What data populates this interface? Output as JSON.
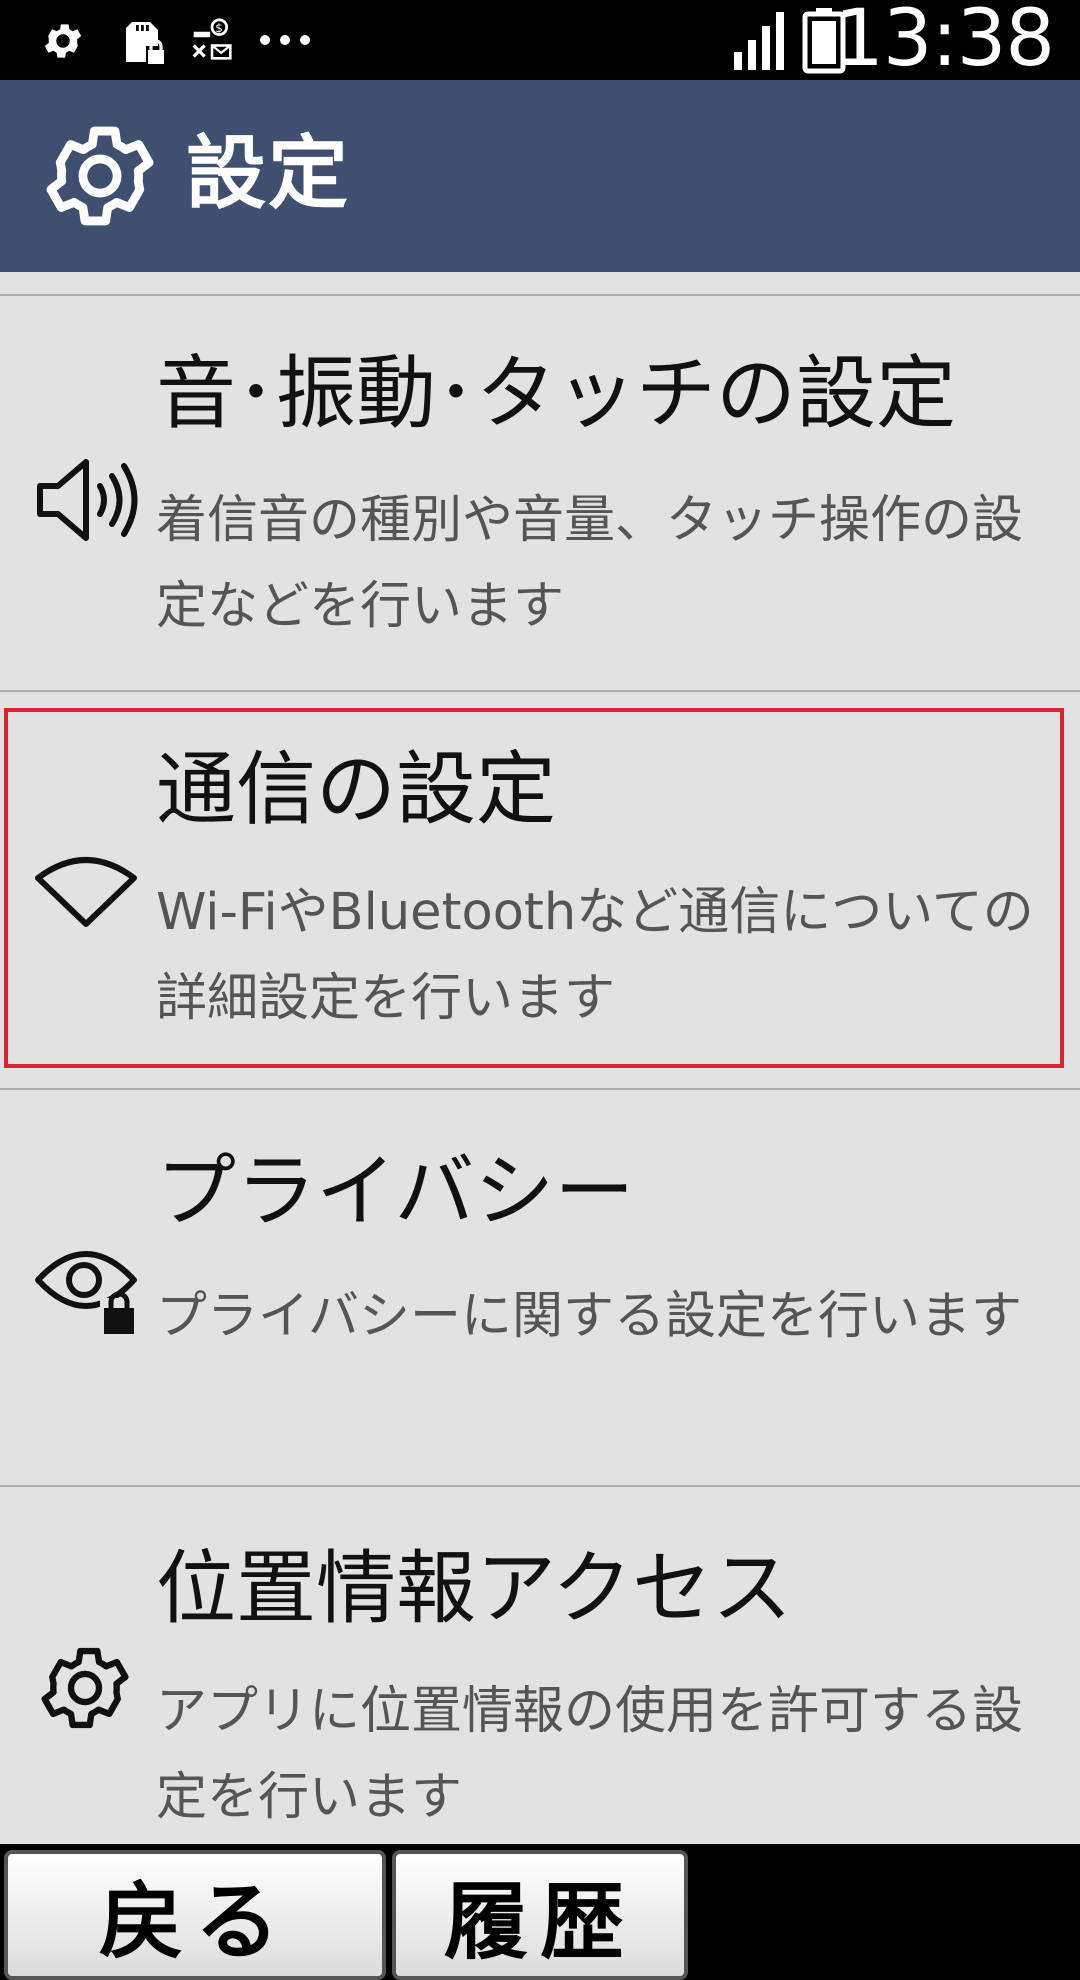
{
  "status_bar": {
    "time": "13:38",
    "icons": [
      "settings-icon",
      "sd-card-lock-icon",
      "key-dollar-mail-icon",
      "more-icon",
      "signal-icon",
      "battery-icon"
    ]
  },
  "app_bar": {
    "title": "設定",
    "icon": "gear-icon"
  },
  "items": [
    {
      "title": "音･振動･タッチの設定",
      "description": "着信音の種別や音量、タッチ操作の設定などを行います",
      "icon": "speaker-icon"
    },
    {
      "title": "通信の設定",
      "description": "Wi-FiやBluetoothなど通信についての詳細設定を行います",
      "icon": "wifi-icon",
      "selected": true
    },
    {
      "title": "プライバシー",
      "description": "プライバシーに関する設定を行います",
      "icon": "eye-lock-icon"
    },
    {
      "title": "位置情報アクセス",
      "description": "アプリに位置情報の使用を許可する設定を行います",
      "icon": "gear-icon"
    }
  ],
  "bottom_bar": {
    "back_label": "戻る",
    "history_label": "履歴"
  },
  "colors": {
    "app_bar": "#3f4f70",
    "list_background": "#e2e2e2",
    "selection_border": "#dd2233"
  }
}
